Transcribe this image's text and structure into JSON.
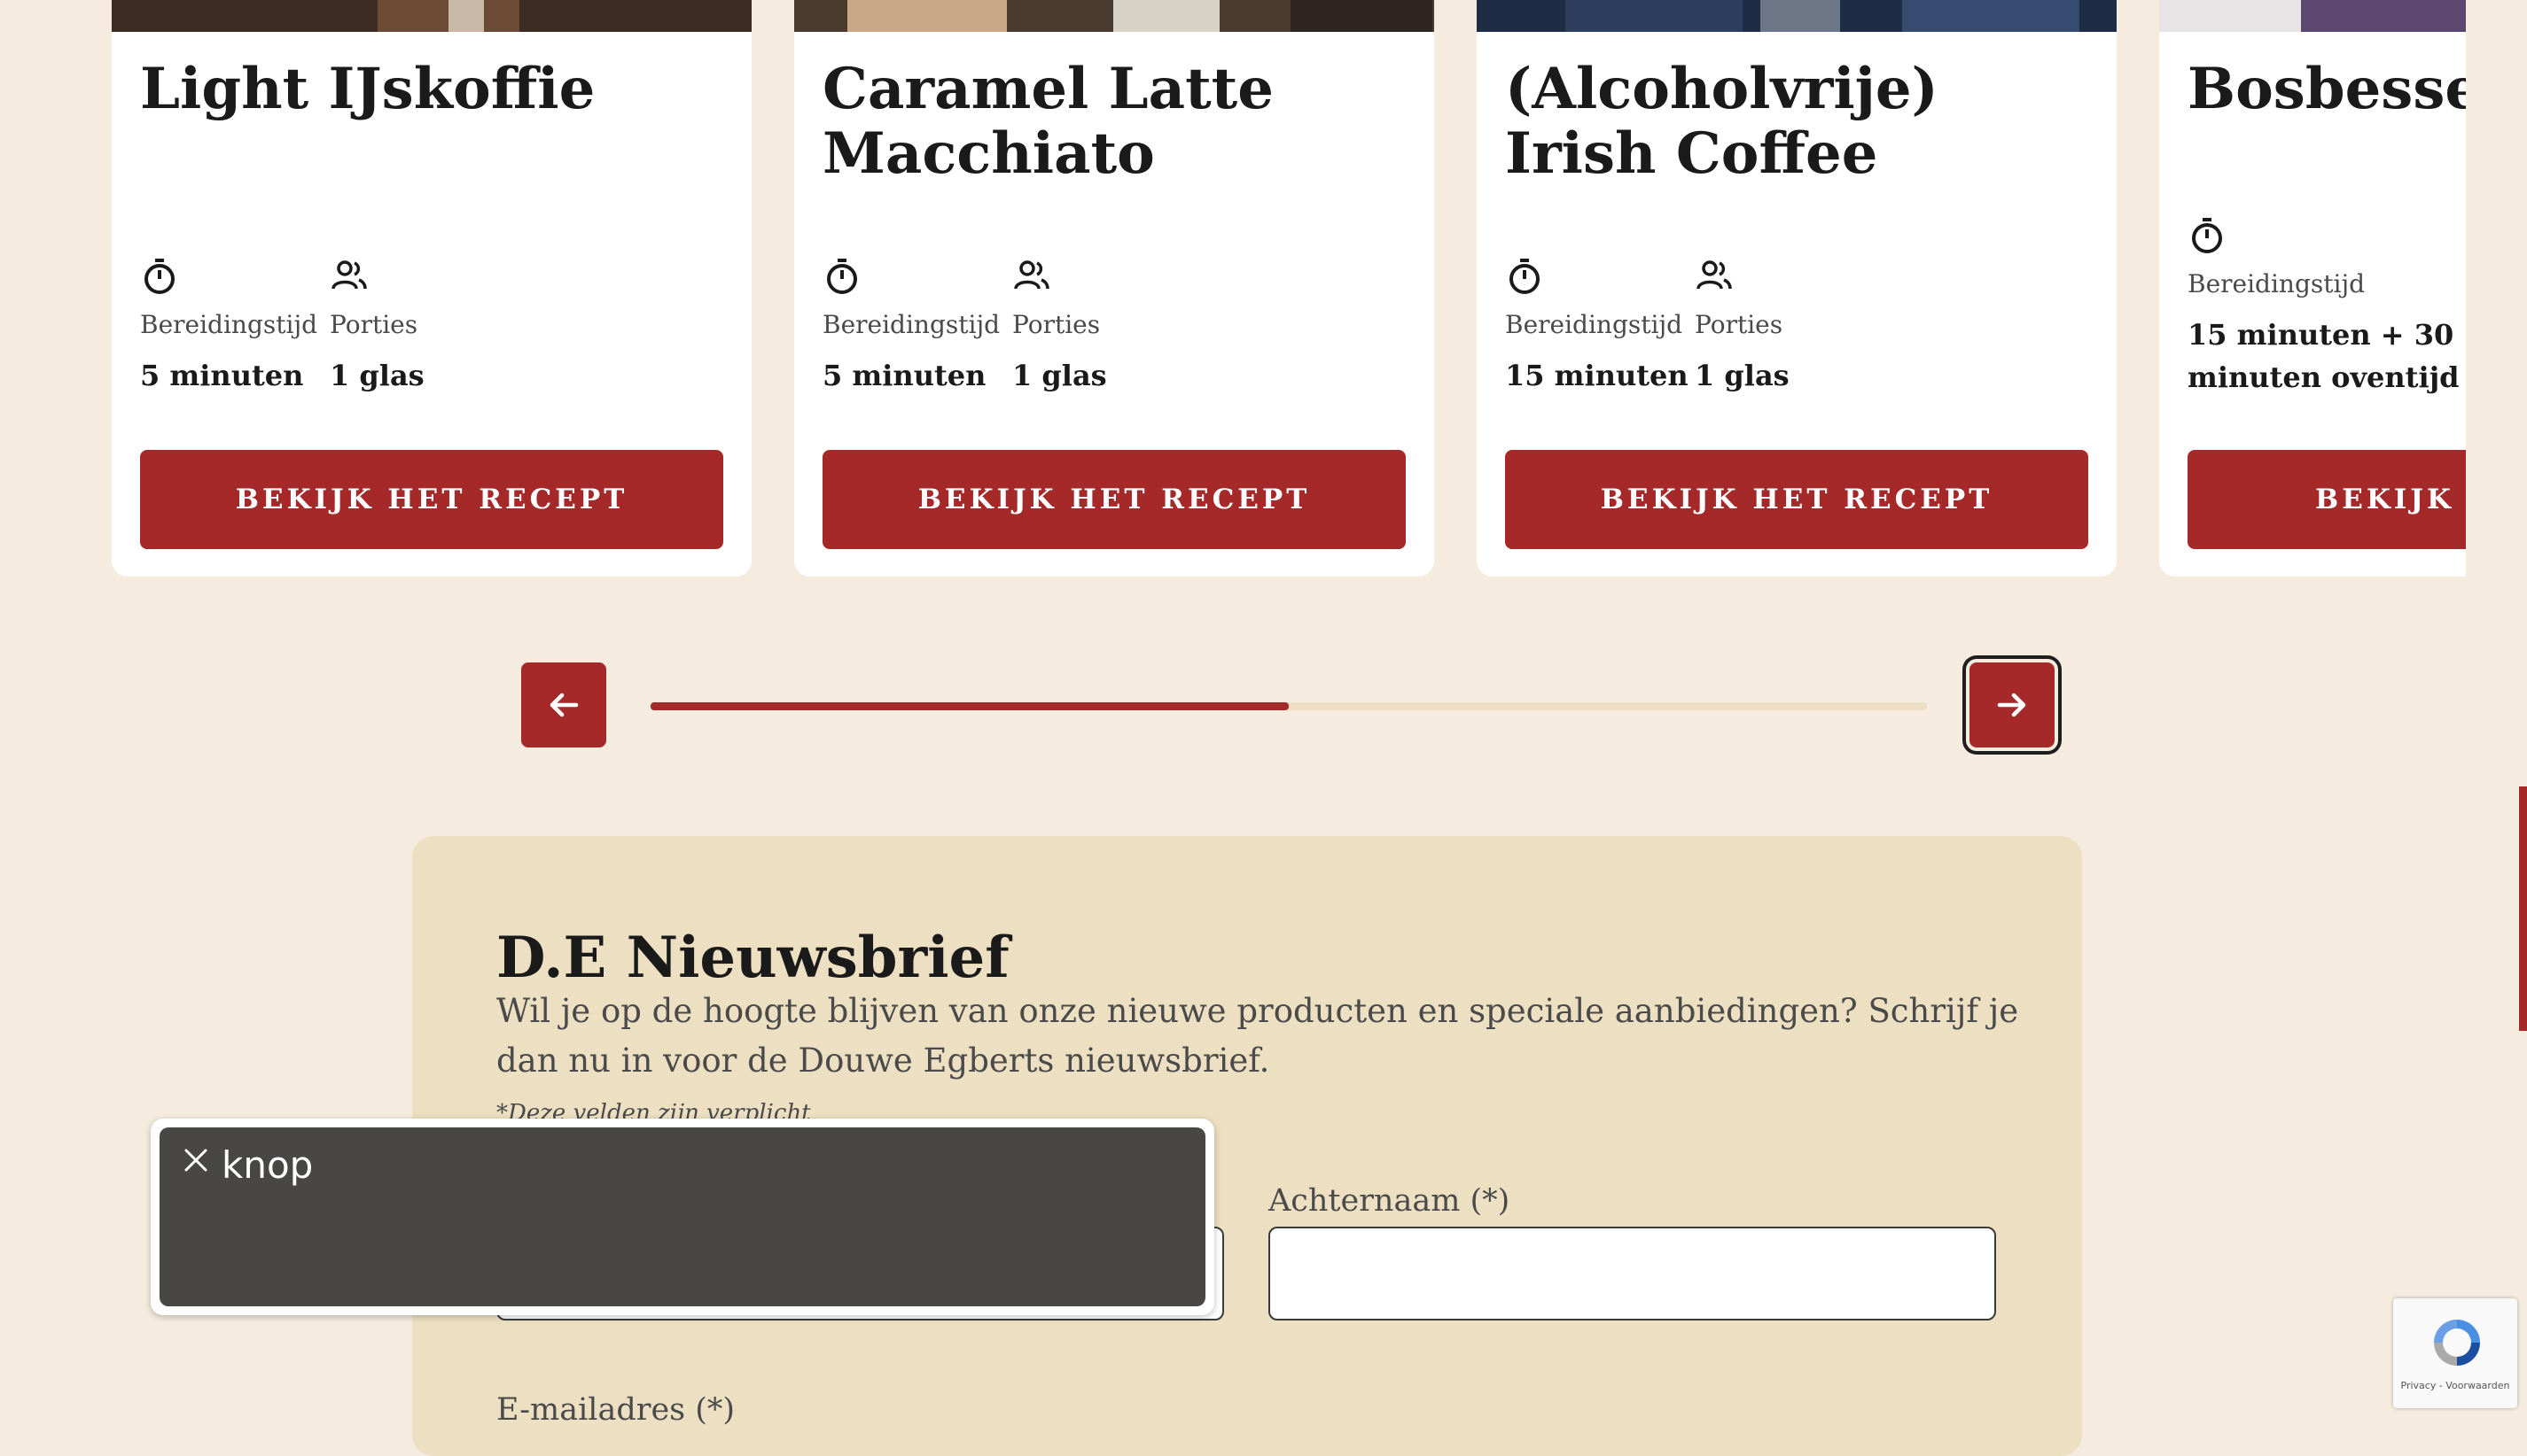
{
  "recipes": [
    {
      "title": "Light IJskoffie",
      "time_label": "Bereidingstijd",
      "time_value": "5 minuten",
      "portions_label": "Porties",
      "portions_value": "1 glas",
      "button_label": "BEKIJK HET RECEPT"
    },
    {
      "title": "Caramel Latte Macchiato",
      "time_label": "Bereidingstijd",
      "time_value": "5 minuten",
      "portions_label": "Porties",
      "portions_value": "1 glas",
      "button_label": "BEKIJK HET RECEPT"
    },
    {
      "title": "(Alcoholvrije) Irish Coffee",
      "time_label": "Bereidingstijd",
      "time_value": "15 minuten",
      "portions_label": "Porties",
      "portions_value": "1 glas",
      "button_label": "BEKIJK HET RECEPT"
    },
    {
      "title": "Bosbessen kruimeltaart",
      "time_label": "Bereidingstijd",
      "time_value": "15 minuten + 30 minuten oventijd",
      "button_label": "BEKIJK HET RECEPT"
    }
  ],
  "carousel": {
    "progress_percent": 50,
    "prev_icon": "arrow-left-icon",
    "next_icon": "arrow-right-icon"
  },
  "newsletter": {
    "title": "D.E Nieuwsbrief",
    "description": "Wil je op de hoogte blijven van onze nieuwe producten en speciale aanbiedingen? Schrijf je dan nu in voor de Douwe Egberts nieuwsbrief.",
    "required_note": "*Deze velden zijn verplicht",
    "lastname_label": "Achternaam (*)",
    "lastname_value": "",
    "email_label": "E-mailadres (*)"
  },
  "tooltip": {
    "text": "knop",
    "close_icon": "close-icon"
  },
  "recaptcha": {
    "links": "Privacy - Voorwaarden"
  },
  "colors": {
    "brand_red": "#a6292a",
    "background": "#f5ecdf",
    "panel": "#ede0c2",
    "track": "#ecdfc4"
  }
}
